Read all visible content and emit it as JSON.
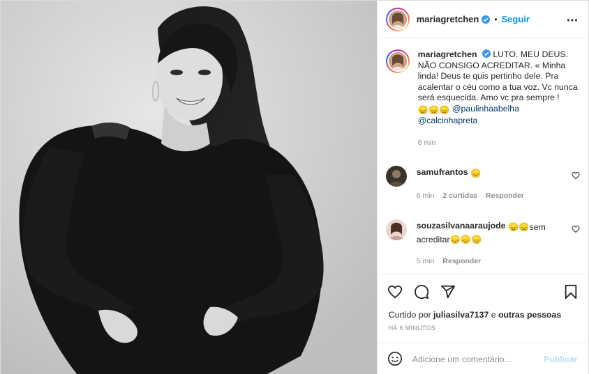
{
  "header": {
    "username": "mariagretchen",
    "separator": "•",
    "follow_label": "Seguir",
    "more_icon": "more-horizontal-icon"
  },
  "caption": {
    "username": "mariagretchen",
    "text_1": "LUTO. MEU DEUS. NÃO CONSIGO ACREDITAR. « Minha linda! Deus te quis pertinho dele. Pra acalentar o céu como a tua voz. Vc nunca será esquecida. Amo vc pra sempre !",
    "emoji": "😞😞😞",
    "mention_1": "@paulinhaabelha",
    "mention_2": "@calcinhapreta",
    "time": "6 min"
  },
  "comments": [
    {
      "username": "samufrantos",
      "text": "😞",
      "time": "6 min",
      "likes": "2 curtidas",
      "reply": "Responder"
    },
    {
      "username": "souzasilvanaaraujode",
      "text_a": "😞😞sem",
      "text_b": "acreditar😞😞😞",
      "time": "5 min",
      "reply": "Responder"
    }
  ],
  "actions": {
    "liked_prefix": "Curtido por",
    "liked_user": "juliasilva7137",
    "liked_and": "e",
    "liked_others": "outras pessoas",
    "ago": "HÁ 6 MINUTOS"
  },
  "add_comment": {
    "emoji_icon": "smiley-icon",
    "placeholder": "Adicione um comentário...",
    "publish_label": "Publicar"
  },
  "colors": {
    "accent_blue": "#0095f6",
    "mention_blue": "#00376b",
    "muted": "#8e8e8e",
    "publish_disabled": "#b2dffc"
  }
}
